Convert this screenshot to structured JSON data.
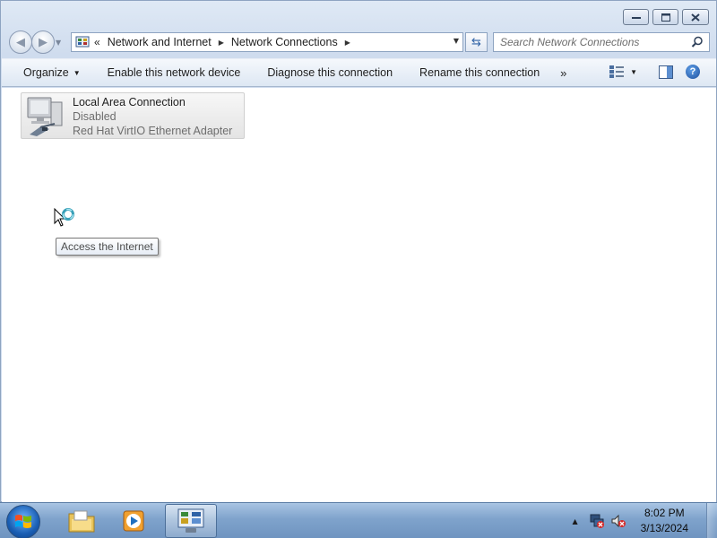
{
  "window": {
    "controls": {
      "minimize": "minimize-icon",
      "maximize": "maximize-icon",
      "close": "close-icon"
    }
  },
  "address": {
    "overflow": "«",
    "crumbs": [
      "Network and Internet",
      "Network Connections"
    ]
  },
  "search": {
    "placeholder": "Search Network Connections"
  },
  "toolbar": {
    "organize": "Organize",
    "enable": "Enable this network device",
    "diagnose": "Diagnose this connection",
    "rename": "Rename this connection",
    "more": "»"
  },
  "connection": {
    "name": "Local Area Connection",
    "status": "Disabled",
    "adapter": "Red Hat VirtIO Ethernet Adapter"
  },
  "tooltip": {
    "text": "Access the Internet"
  },
  "taskbar": {
    "apps": [
      "windows-explorer-icon",
      "media-player-icon",
      "network-connections-icon"
    ],
    "clock": {
      "time": "8:02 PM",
      "date": "3/13/2024"
    }
  },
  "colors": {
    "accent": "#2f62a6",
    "taskbar": "#7fa3cc",
    "window_frame": "#cfdcee"
  }
}
